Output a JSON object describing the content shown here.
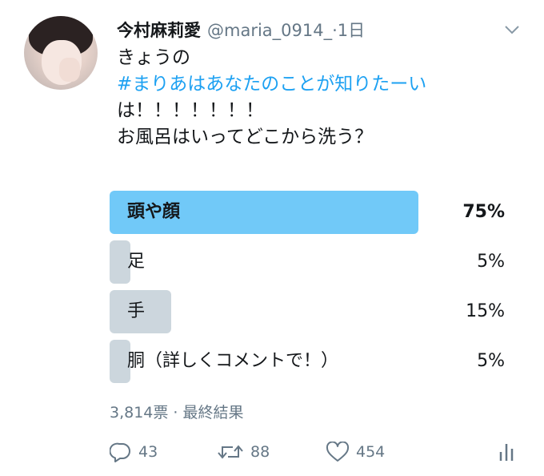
{
  "tweet": {
    "author_name": "今村麻莉愛",
    "author_handle": "@maria_0914_·1日",
    "text_lines": [
      "きょうの",
      "#まりあはあなたのことが知りたーい",
      "は！！！！！！！",
      "お風呂はいってどこから洗う？"
    ]
  },
  "poll": {
    "options": [
      {
        "label": "頭や顔",
        "percent_text": "75%",
        "fill_fraction": 0.75,
        "winner": true
      },
      {
        "label": "足",
        "percent_text": "5%",
        "fill_fraction": 0.05,
        "winner": false
      },
      {
        "label": "手",
        "percent_text": "15%",
        "fill_fraction": 0.15,
        "winner": false
      },
      {
        "label": "胴（詳しくコメントで！）",
        "percent_text": "5%",
        "fill_fraction": 0.05,
        "winner": false
      }
    ],
    "meta": "3,814票 · 最終結果"
  },
  "actions": {
    "reply_count": "43",
    "retweet_count": "88",
    "like_count": "454"
  },
  "colors": {
    "hashtag": "#1da1f2",
    "winner_bar": "#71c9f8",
    "other_bar": "#ccd6dd",
    "muted_text": "#657786"
  },
  "icons": [
    "chevron-down-icon",
    "reply-icon",
    "retweet-icon",
    "like-icon",
    "analytics-icon"
  ]
}
